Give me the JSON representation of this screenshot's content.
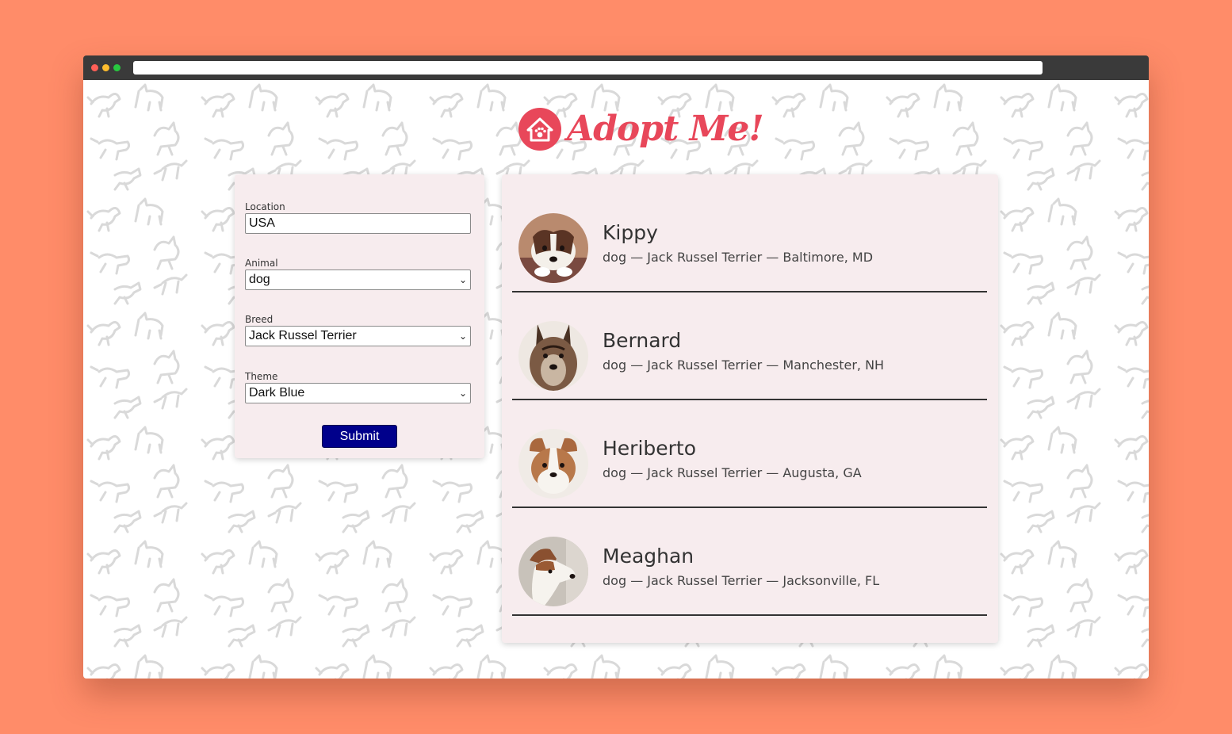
{
  "app": {
    "brand_name": "Adopt Me!",
    "colors": {
      "page_background": "#ff8c69",
      "brand": "#e8475a",
      "panel": "#f7ecee",
      "submit": "#00008b"
    }
  },
  "search": {
    "location": {
      "label": "Location",
      "value": "USA"
    },
    "animal": {
      "label": "Animal",
      "selected": "dog"
    },
    "breed": {
      "label": "Breed",
      "selected": "Jack Russel Terrier"
    },
    "theme": {
      "label": "Theme",
      "selected": "Dark Blue"
    },
    "submit_label": "Submit"
  },
  "results": [
    {
      "name": "Kippy",
      "info": "dog — Jack Russel Terrier — Baltimore, MD"
    },
    {
      "name": "Bernard",
      "info": "dog — Jack Russel Terrier — Manchester, NH"
    },
    {
      "name": "Heriberto",
      "info": "dog — Jack Russel Terrier — Augusta, GA"
    },
    {
      "name": "Meaghan",
      "info": "dog — Jack Russel Terrier — Jacksonville, FL"
    }
  ]
}
